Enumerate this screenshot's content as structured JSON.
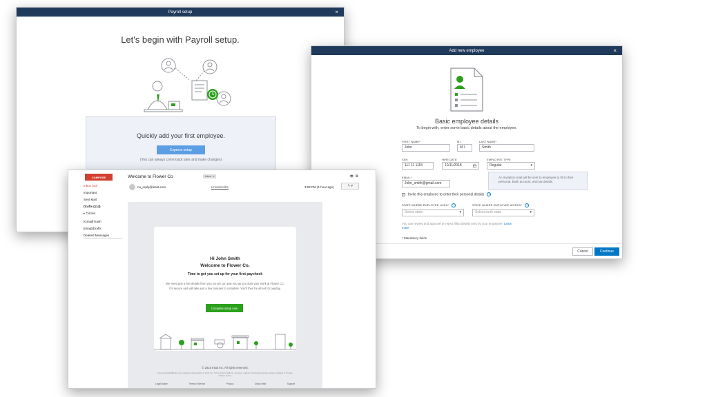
{
  "payroll": {
    "title": "Payroll setup",
    "close": "×",
    "heading": "Let's begin with Payroll setup.",
    "panel_title": "Quickly add your first employee.",
    "express_button": "Express setup",
    "hint": "(You can always come back later and make changes)"
  },
  "employee": {
    "title": "Add new employee",
    "close": "×",
    "heading": "Basic employee details",
    "subheading": "To begin with, enter some basic details about the employee.",
    "fields": {
      "first_name": {
        "label": "FIRST NAME*",
        "value": "John"
      },
      "mi": {
        "label": "M.I.",
        "value": "M.I."
      },
      "last_name": {
        "label": "LAST NAME*",
        "value": "Smith"
      },
      "ssn": {
        "label": "SSN",
        "value": "111 11 1118"
      },
      "hire_date": {
        "label": "HIRE DATE",
        "value": "10/11/2018"
      },
      "employee_type": {
        "label": "EMPLOYEE TYPE",
        "value": "Regular"
      },
      "email": {
        "label": "EMAIL*",
        "value": "John_smith@gmail.com"
      },
      "state_lives": {
        "label": "STATE WHERE EMPLOYEE LIVES*",
        "placeholder": "Select state"
      },
      "state_works": {
        "label": "STATE WHERE EMPLOYEE WORKS*",
        "placeholder": "Select work state"
      }
    },
    "tooltip": "An invitation mail will be sent to employee to fill in their personal, bank account, and tax details.",
    "invite_label": "Invite this employee to enter their personal details",
    "invite_check": "✓",
    "note": "You can review and approve or reject filled details sent by your employee.",
    "learn_more": "Learn more",
    "mandatory": "* Mandatory fields",
    "cancel": "Cancel",
    "continue": "Continue",
    "calendar_icon": "calendar-icon",
    "dropdown_caret": "▾",
    "help_glyph": "?"
  },
  "email": {
    "compose": "COMPOSE",
    "nav": [
      {
        "label": "Inbox (10)"
      },
      {
        "label": "Important"
      },
      {
        "label": "Sent Mail"
      },
      {
        "label": "Drafts (114)"
      },
      {
        "label": "▸ Circles"
      },
      {
        "label": "[Gmail]Trash"
      },
      {
        "label": "[Imap]/Drafts"
      },
      {
        "label": "Deleted Messages"
      }
    ],
    "subject": "Welcome to Flower Co",
    "tag": "Inbox",
    "tag_close": "x",
    "sender": "no_reply@intuit.com",
    "unsubscribe": "Unsubscribe",
    "time": "3:02 PM (1 hour ago)",
    "reply_glyph": "↰ ▾",
    "print_glyph": "🖶",
    "popout_glyph": "⧉",
    "greeting": "Hi John Smith",
    "welcome": "Welcome to Flower Co.",
    "tagline": "Time to get you set up for your first paycheck",
    "paragraph": "We need just a few details from you, so we can pay you as you start your work at Flower Co. It's secure and will take just a few minutes to complete. You'll then be all set for payday.",
    "cta": "Complete setup now",
    "copyright": "© 2018 Intuit Inc. All rights reserved.",
    "legal": "Intuit and QuickBooks are registered trademarks of Intuit Inc. Terms and conditions, features, support, pricing and service options subject to change without notice.",
    "links": [
      "Legal Notice",
      "Terms of Service",
      "Privacy",
      "About Intuit",
      "Support"
    ]
  }
}
